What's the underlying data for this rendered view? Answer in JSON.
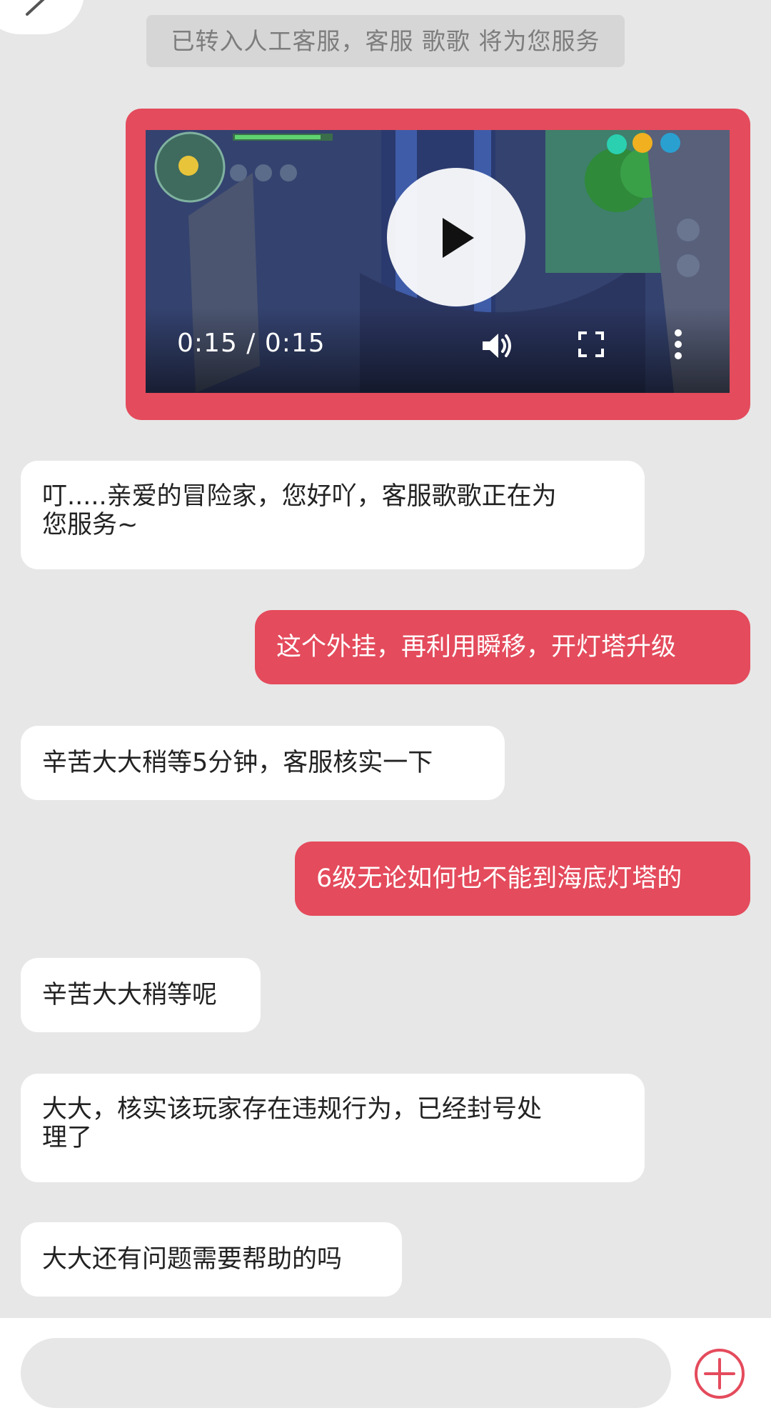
{
  "system_notice": "已转入人工客服，客服 歌歌 将为您服务",
  "video": {
    "time": "0:15 / 0:15"
  },
  "messages": [
    {
      "side": "in",
      "text": "叮.....亲爱的冒险家，您好吖，客服歌歌正在为\n您服务~"
    },
    {
      "side": "out",
      "text": "这个外挂，再利用瞬移，开灯塔升级"
    },
    {
      "side": "in",
      "text": "辛苦大大稍等5分钟，客服核实一下"
    },
    {
      "side": "out",
      "text": "6级无论如何也不能到海底灯塔的"
    },
    {
      "side": "in",
      "text": "辛苦大大稍等呢"
    },
    {
      "side": "in",
      "text": "大大，核实该玩家存在违规行为，已经封号处\n理了"
    },
    {
      "side": "in",
      "text": "大大还有问题需要帮助的吗"
    }
  ],
  "input": {
    "placeholder": ""
  },
  "icons": {
    "corner": "pen-icon",
    "play": "play-icon",
    "volume": "volume-icon",
    "fullscreen": "fullscreen-icon",
    "more": "more-vertical-icon",
    "add": "plus-circle-icon"
  },
  "colors": {
    "accent": "#e44b5c",
    "background": "#e7e7e7",
    "incoming_bubble": "#ffffff",
    "notice_bg": "#d6d6d6"
  }
}
